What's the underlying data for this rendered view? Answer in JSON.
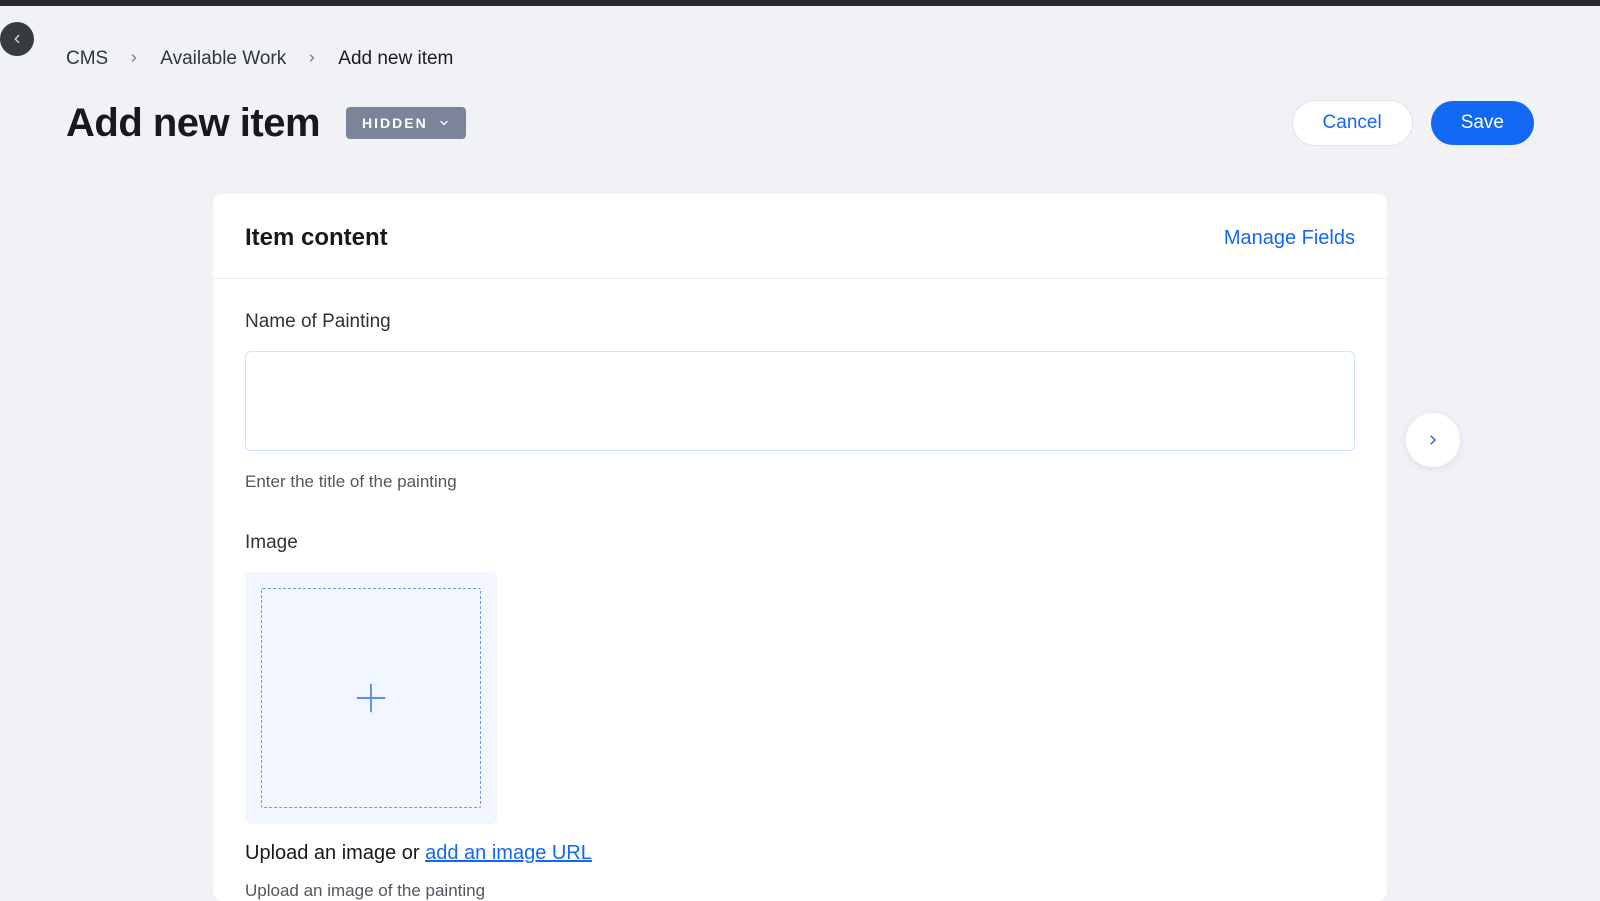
{
  "breadcrumbs": {
    "item1": "CMS",
    "item2": "Available Work",
    "item3": "Add new item"
  },
  "page": {
    "title": "Add new item",
    "status_badge": "HIDDEN"
  },
  "actions": {
    "cancel": "Cancel",
    "save": "Save"
  },
  "card": {
    "title": "Item content",
    "manage_fields": "Manage Fields"
  },
  "fields": {
    "name": {
      "label": "Name of Painting",
      "value": "",
      "help": "Enter the title of the painting"
    },
    "image": {
      "label": "Image",
      "upload_prefix": "Upload an image or ",
      "upload_link": "add an image URL",
      "help": "Upload an image of the painting"
    }
  }
}
